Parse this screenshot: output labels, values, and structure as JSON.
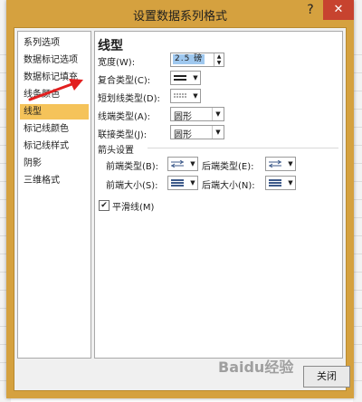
{
  "dialog": {
    "title": "设置数据系列格式",
    "help": "?",
    "close": "✕"
  },
  "nav": {
    "items": [
      {
        "label": "系列选项",
        "active": false
      },
      {
        "label": "数据标记选项",
        "active": false
      },
      {
        "label": "数据标记填充",
        "active": false
      },
      {
        "label": "线条颜色",
        "active": false
      },
      {
        "label": "线型",
        "active": true
      },
      {
        "label": "标记线颜色",
        "active": false
      },
      {
        "label": "标记线样式",
        "active": false
      },
      {
        "label": "阴影",
        "active": false
      },
      {
        "label": "三维格式",
        "active": false
      }
    ]
  },
  "panel": {
    "heading": "线型",
    "width_label": "宽度(W):",
    "width_value": "2.5 磅",
    "compound_label": "复合类型(C):",
    "dash_label": "短划线类型(D):",
    "cap_label": "线端类型(A):",
    "cap_value": "圆形",
    "join_label": "联接类型(J):",
    "join_value": "圆形",
    "arrow_section": "箭头设置",
    "begin_type_label": "前端类型(B):",
    "end_type_label": "后端类型(E):",
    "begin_size_label": "前端大小(S):",
    "end_size_label": "后端大小(N):",
    "smooth_label": "平滑线(M)",
    "smooth_checked": "✔"
  },
  "footer": {
    "close_label": "关闭"
  },
  "watermark": "Baidu经验"
}
